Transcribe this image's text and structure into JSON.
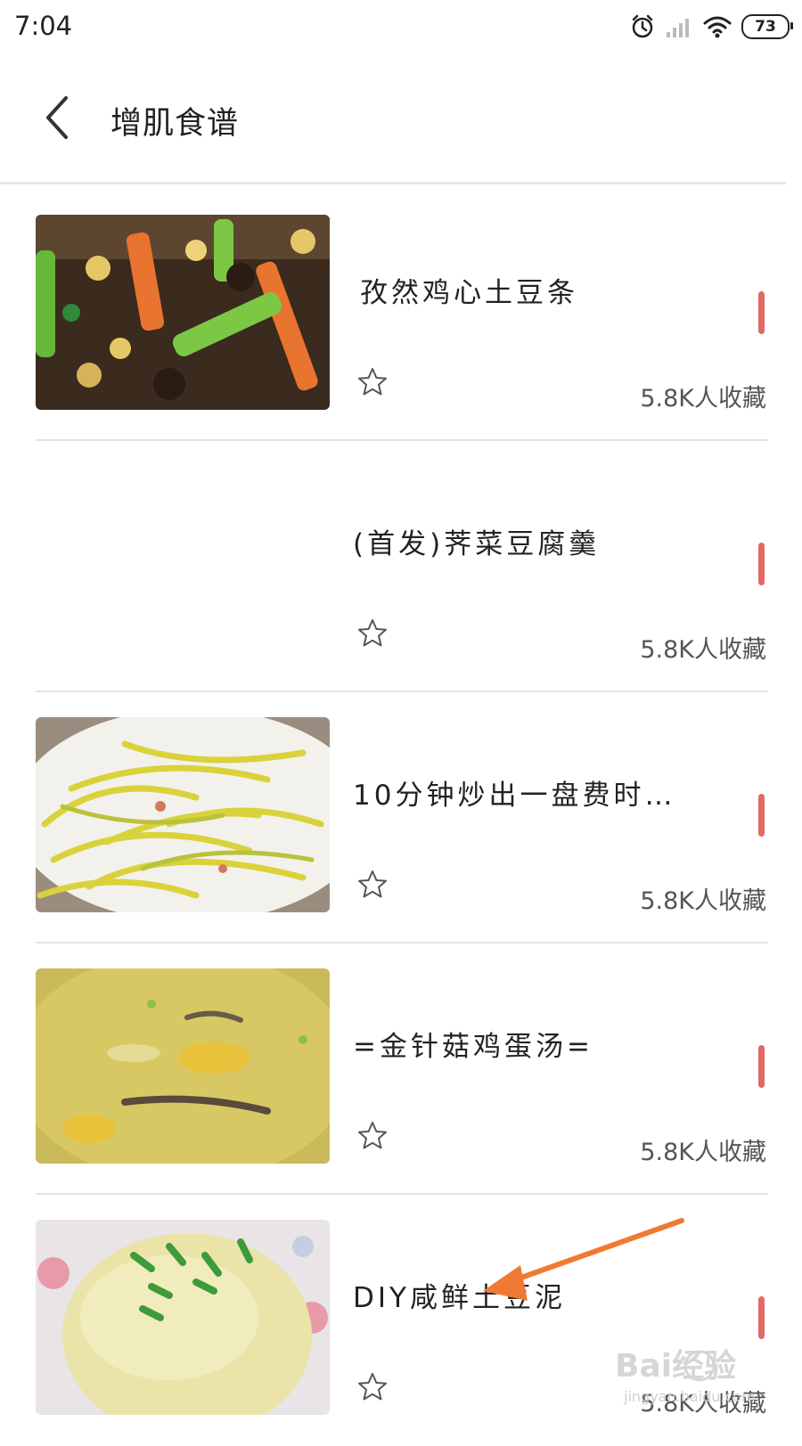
{
  "status_bar": {
    "time": "7:04",
    "battery": "73",
    "icons": [
      "alarm-icon",
      "signal-icon",
      "wifi-icon",
      "battery-icon"
    ]
  },
  "header": {
    "title": "增肌食谱",
    "back_icon": "chevron-left-icon"
  },
  "colors": {
    "accent": "#e06a66",
    "divider": "#e3e3e3",
    "text": "#222222",
    "annotation_arrow": "#f07a33"
  },
  "recipes": [
    {
      "title": " 孜然鸡心土豆条",
      "favorites": "5.8K人收藏",
      "image": "stir-fried-chicken-hearts-potato-sticks"
    },
    {
      "title": "(首发)荠菜豆腐羹",
      "favorites": "5.8K人收藏",
      "image": ""
    },
    {
      "title": "10分钟炒出一盘费时…",
      "favorites": "5.8K人收藏",
      "image": "stir-fried-shredded-vegetables"
    },
    {
      "title": "=金针菇鸡蛋汤=",
      "favorites": "5.8K人收藏",
      "image": "egg-drop-soup"
    },
    {
      "title": "DIY咸鲜土豆泥",
      "favorites": "5.8K人收藏",
      "image": "mashed-potato-with-scallions"
    }
  ],
  "watermark": {
    "text": "Bai经验",
    "subtext": "jingyan.baidu.com"
  }
}
